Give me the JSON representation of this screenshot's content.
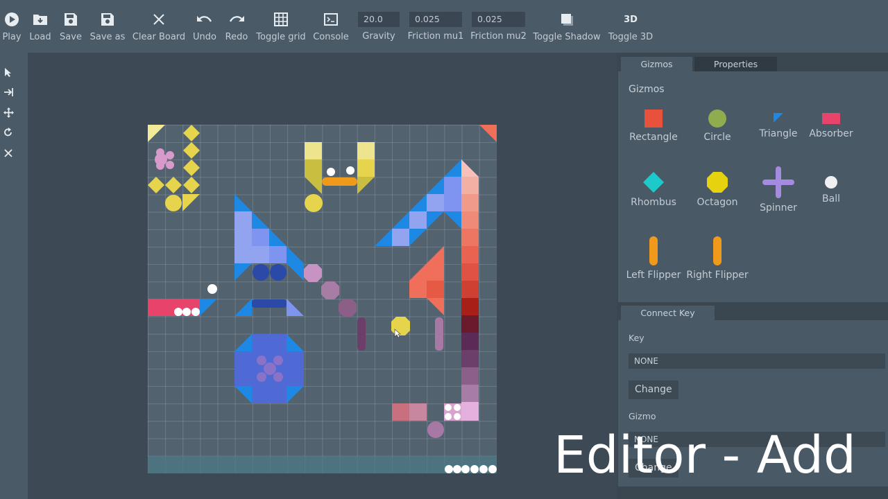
{
  "toolbar": {
    "play": "Play",
    "load": "Load",
    "save": "Save",
    "save_as": "Save as",
    "clear_board": "Clear Board",
    "undo": "Undo",
    "redo": "Redo",
    "toggle_grid": "Toggle grid",
    "console": "Console",
    "gravity_label": "Gravity",
    "gravity_value": "20.0",
    "friction_mu1_label": "Friction mu1",
    "friction_mu1_value": "0.025",
    "friction_mu2_label": "Friction mu2",
    "friction_mu2_value": "0.025",
    "toggle_shadow": "Toggle Shadow",
    "toggle_3d": "Toggle 3D",
    "toggle_3d_icon_text": "3D"
  },
  "tabs": {
    "gizmos": "Gizmos",
    "properties": "Properties"
  },
  "gizmos": {
    "title": "Gizmos",
    "items": [
      {
        "label": "Rectangle",
        "icon": "rectangle-icon",
        "color": "#e8523c"
      },
      {
        "label": "Circle",
        "icon": "circle-icon",
        "color": "#8fad4e"
      },
      {
        "label": "Triangle",
        "icon": "triangle-icon",
        "color": "#1e88e5"
      },
      {
        "label": "Absorber",
        "icon": "absorber-icon",
        "color": "#e8436a"
      },
      {
        "label": "Rhombus",
        "icon": "rhombus-icon",
        "color": "#1ec9c9"
      },
      {
        "label": "Octagon",
        "icon": "octagon-icon",
        "color": "#e6d20e"
      },
      {
        "label": "Spinner",
        "icon": "spinner-icon",
        "color": "#a58be0"
      },
      {
        "label": "Ball",
        "icon": "ball-icon",
        "color": "#f0f0f0"
      },
      {
        "label": "Left Flipper",
        "icon": "left-flipper-icon",
        "color": "#ef9a1a"
      },
      {
        "label": "Right Flipper",
        "icon": "right-flipper-icon",
        "color": "#ef9a1a"
      }
    ]
  },
  "connect_key": {
    "tab": "Connect Key",
    "key_label": "Key",
    "key_value": "NONE",
    "change_key": "Change",
    "gizmo_label": "Gizmo",
    "gizmo_value": "NONE",
    "change_gizmo": "Change"
  },
  "overlay": {
    "caption": "Editor - Add"
  },
  "colors": {
    "toolbar_bg": "#4b5a67",
    "board_bg": "#52626f",
    "panel_bg": "#4a5966",
    "app_bg": "#3d4a55"
  }
}
